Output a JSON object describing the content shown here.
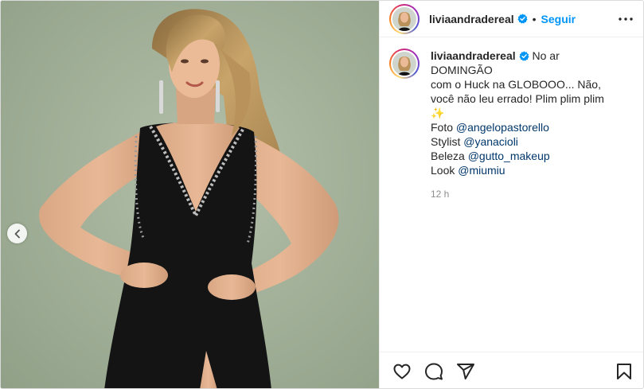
{
  "post": {
    "username": "liviaandradereal",
    "follow_label": "Seguir",
    "separator": "•",
    "media": {
      "background_color": "#9fae95",
      "prev_icon": "chevron-left-icon"
    },
    "caption": {
      "username": "liviaandradereal",
      "text_line1": "No ar DOMINGÃO",
      "text_line2": "com o Huck na GLOBOOO... Não,",
      "text_line3": "você não leu errado! Plim plim plim",
      "sparkle": "✨",
      "credits": [
        {
          "label": "Foto ",
          "mention": "@angelopastorello"
        },
        {
          "label": "Stylist ",
          "mention": "@yanacioli"
        },
        {
          "label": "Beleza ",
          "mention": "@gutto_makeup"
        },
        {
          "label": "Look ",
          "mention": "@miumiu"
        }
      ]
    },
    "timestamp": "12 h",
    "actions": {
      "like_icon": "heart-icon",
      "comment_icon": "comment-icon",
      "share_icon": "paper-plane-icon",
      "save_icon": "bookmark-icon"
    },
    "colors": {
      "follow": "#0095f6",
      "mention": "#00376b",
      "verified": "#0095f6"
    }
  }
}
